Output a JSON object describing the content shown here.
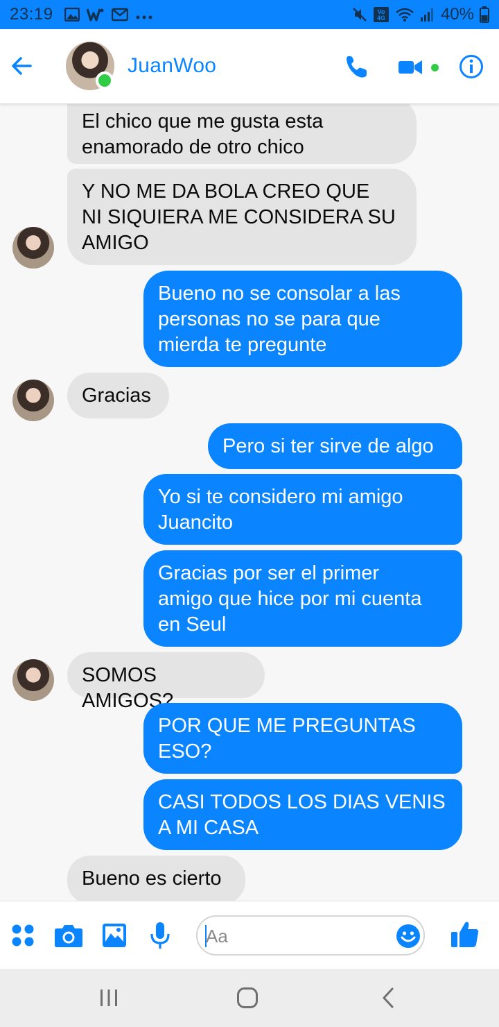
{
  "status_bar": {
    "time": "23:19",
    "notification_icons": [
      "gallery-icon",
      "w-app-icon",
      "gmail-icon",
      "more-dots-icon"
    ],
    "battery": "40%",
    "status_icons": [
      "mute-icon",
      "volte-icon",
      "wifi-icon",
      "signal-icon",
      "battery-icon"
    ]
  },
  "header": {
    "contact_name": "JuanWoo",
    "online": true,
    "actions": [
      "back-arrow-icon",
      "phone-icon",
      "video-camera-icon",
      "info-icon"
    ]
  },
  "messages": [
    {
      "sender": "them",
      "text": "El chico que me gusta esta\nenamorado de otro chico",
      "avatar": false
    },
    {
      "sender": "them",
      "text": "Y NO ME DA BOLA CREO QUE\nNI SIQUIERA ME CONSIDERA SU\nAMIGO",
      "avatar": true
    },
    {
      "sender": "me",
      "text": "Bueno no se consolar a las\npersonas no se para que\nmierda te pregunte",
      "avatar": false
    },
    {
      "sender": "them",
      "text": "Gracias",
      "avatar": true
    },
    {
      "sender": "me",
      "text": "Pero si ter sirve de algo",
      "avatar": false
    },
    {
      "sender": "me",
      "text": "Yo si te considero mi amigo\nJuancito",
      "avatar": false
    },
    {
      "sender": "me",
      "text": "Gracias por ser el primer\namigo que hice por mi cuenta\nen Seul",
      "avatar": false
    },
    {
      "sender": "them",
      "text": "SOMOS AMIGOS?",
      "avatar": true
    },
    {
      "sender": "me",
      "text": "POR QUE ME PREGUNTAS\nESO?",
      "avatar": false
    },
    {
      "sender": "me",
      "text": "CASI TODOS LOS DIAS VENIS\nA MI CASA",
      "avatar": false
    },
    {
      "sender": "them",
      "text": "Bueno es cierto",
      "avatar": false
    }
  ],
  "composer": {
    "placeholder": "Aa",
    "value": "",
    "icons": [
      "apps-grid-icon",
      "camera-icon",
      "image-icon",
      "microphone-icon",
      "emoji-icon",
      "thumbs-up-icon"
    ]
  },
  "nav_bar": {
    "buttons": [
      "recent-apps-icon",
      "home-icon",
      "back-icon"
    ]
  },
  "colors": {
    "accent": "#0a84ff",
    "incoming_bubble": "#e4e4e4",
    "online": "#31cc46"
  }
}
